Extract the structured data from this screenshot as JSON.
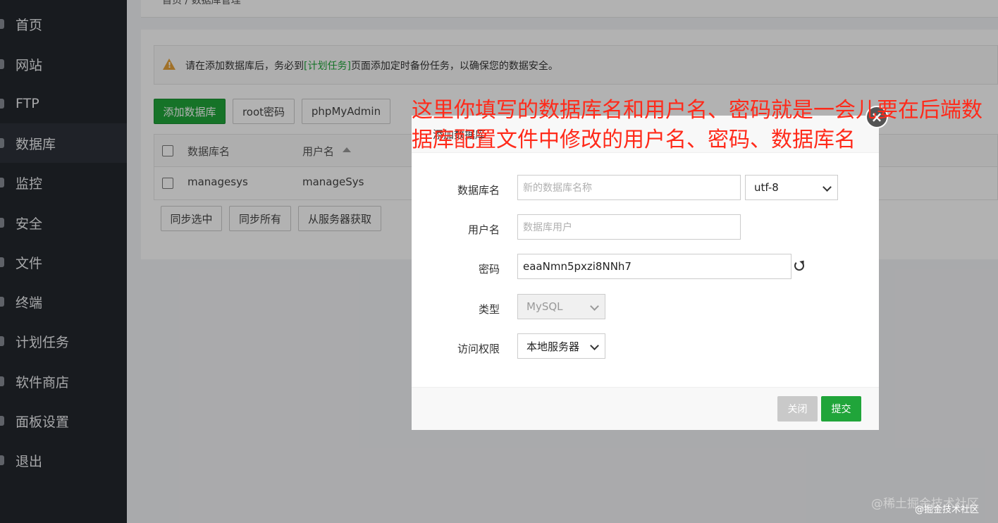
{
  "sidebar": {
    "items": [
      {
        "label": "首页",
        "icon": "home-icon"
      },
      {
        "label": "网站",
        "icon": "globe-icon"
      },
      {
        "label": "FTP",
        "icon": "ftp-icon"
      },
      {
        "label": "数据库",
        "icon": "database-icon",
        "active": true
      },
      {
        "label": "监控",
        "icon": "monitor-icon"
      },
      {
        "label": "安全",
        "icon": "shield-icon"
      },
      {
        "label": "文件",
        "icon": "folder-icon"
      },
      {
        "label": "终端",
        "icon": "terminal-icon"
      },
      {
        "label": "计划任务",
        "icon": "clock-icon"
      },
      {
        "label": "软件商店",
        "icon": "store-icon"
      },
      {
        "label": "面板设置",
        "icon": "gear-icon"
      },
      {
        "label": "退出",
        "icon": "logout-icon"
      }
    ]
  },
  "breadcrumb": "首页 / 数据库管理",
  "alert": {
    "prefix": "请在添加数据库后，务必到",
    "link": "[计划任务]",
    "suffix": "页面添加定时备份任务，以确保您的数据安全。"
  },
  "toolbar": {
    "add_db": "添加数据库",
    "root_password": "root密码",
    "phpmyadmin": "phpMyAdmin"
  },
  "table": {
    "headers": [
      "数据库名",
      "用户名"
    ],
    "rows": [
      {
        "db": "managesys",
        "user": "manageSys"
      }
    ]
  },
  "bottom_buttons": {
    "sync_selected": "同步选中",
    "sync_all": "同步所有",
    "fetch_from_server": "从服务器获取"
  },
  "modal": {
    "title": "添加数据库",
    "db_name_label": "数据库名",
    "db_name_placeholder": "新的数据库名称",
    "charset": "utf-8",
    "username_label": "用户名",
    "username_placeholder": "数据库用户",
    "password_label": "密码",
    "password_value": "eaaNmn5pxzi8NNh7",
    "type_label": "类型",
    "type_value": "MySQL",
    "access_label": "访问权限",
    "access_value": "本地服务器",
    "close_button": "关闭",
    "submit_button": "提交"
  },
  "annotation": "这里你填写的数据库名和用户名、密码就是一会儿要在后端数据库配置文件中修改的用户名、密码、数据库名",
  "watermark": "@稀土掘金技术社区",
  "watermark2": "@掘金技术社区",
  "colors": {
    "accent": "#20a53a",
    "annotation": "#ff2a1a",
    "sidebar": "#23272d"
  }
}
